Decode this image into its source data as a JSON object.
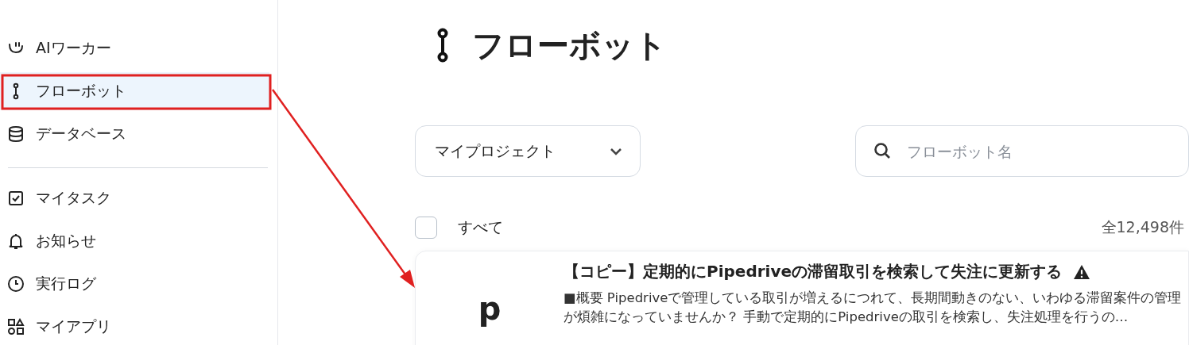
{
  "sidebar": {
    "groups": [
      {
        "items": [
          {
            "label": "AIワーカー",
            "selected": false
          },
          {
            "label": "フローボット",
            "selected": true
          },
          {
            "label": "データベース",
            "selected": false
          }
        ]
      },
      {
        "items": [
          {
            "label": "マイタスク",
            "selected": false
          },
          {
            "label": "お知らせ",
            "selected": false
          },
          {
            "label": "実行ログ",
            "selected": false
          },
          {
            "label": "マイアプリ",
            "selected": false
          }
        ]
      }
    ]
  },
  "page": {
    "title": "フローボット"
  },
  "filters": {
    "project_dropdown": {
      "value": "マイプロジェクト"
    },
    "search": {
      "placeholder": "フローボット名"
    }
  },
  "list_header": {
    "select_all": {
      "label": "すべて",
      "checked": false
    },
    "count": "全12,498件"
  },
  "flowbots": [
    {
      "logo": "p",
      "title": "【コピー】定期的にPipedriveの滞留取引を検索して失注に更新する",
      "warning": true,
      "description": "■概要 Pipedriveで管理している取引が増えるにつれて、長期間動きのない、いわゆる滞留案件の管理が煩雑になっていませんか？ 手動で定期的にPipedriveの取引を検索し、失注処理を行うの…"
    }
  ]
}
